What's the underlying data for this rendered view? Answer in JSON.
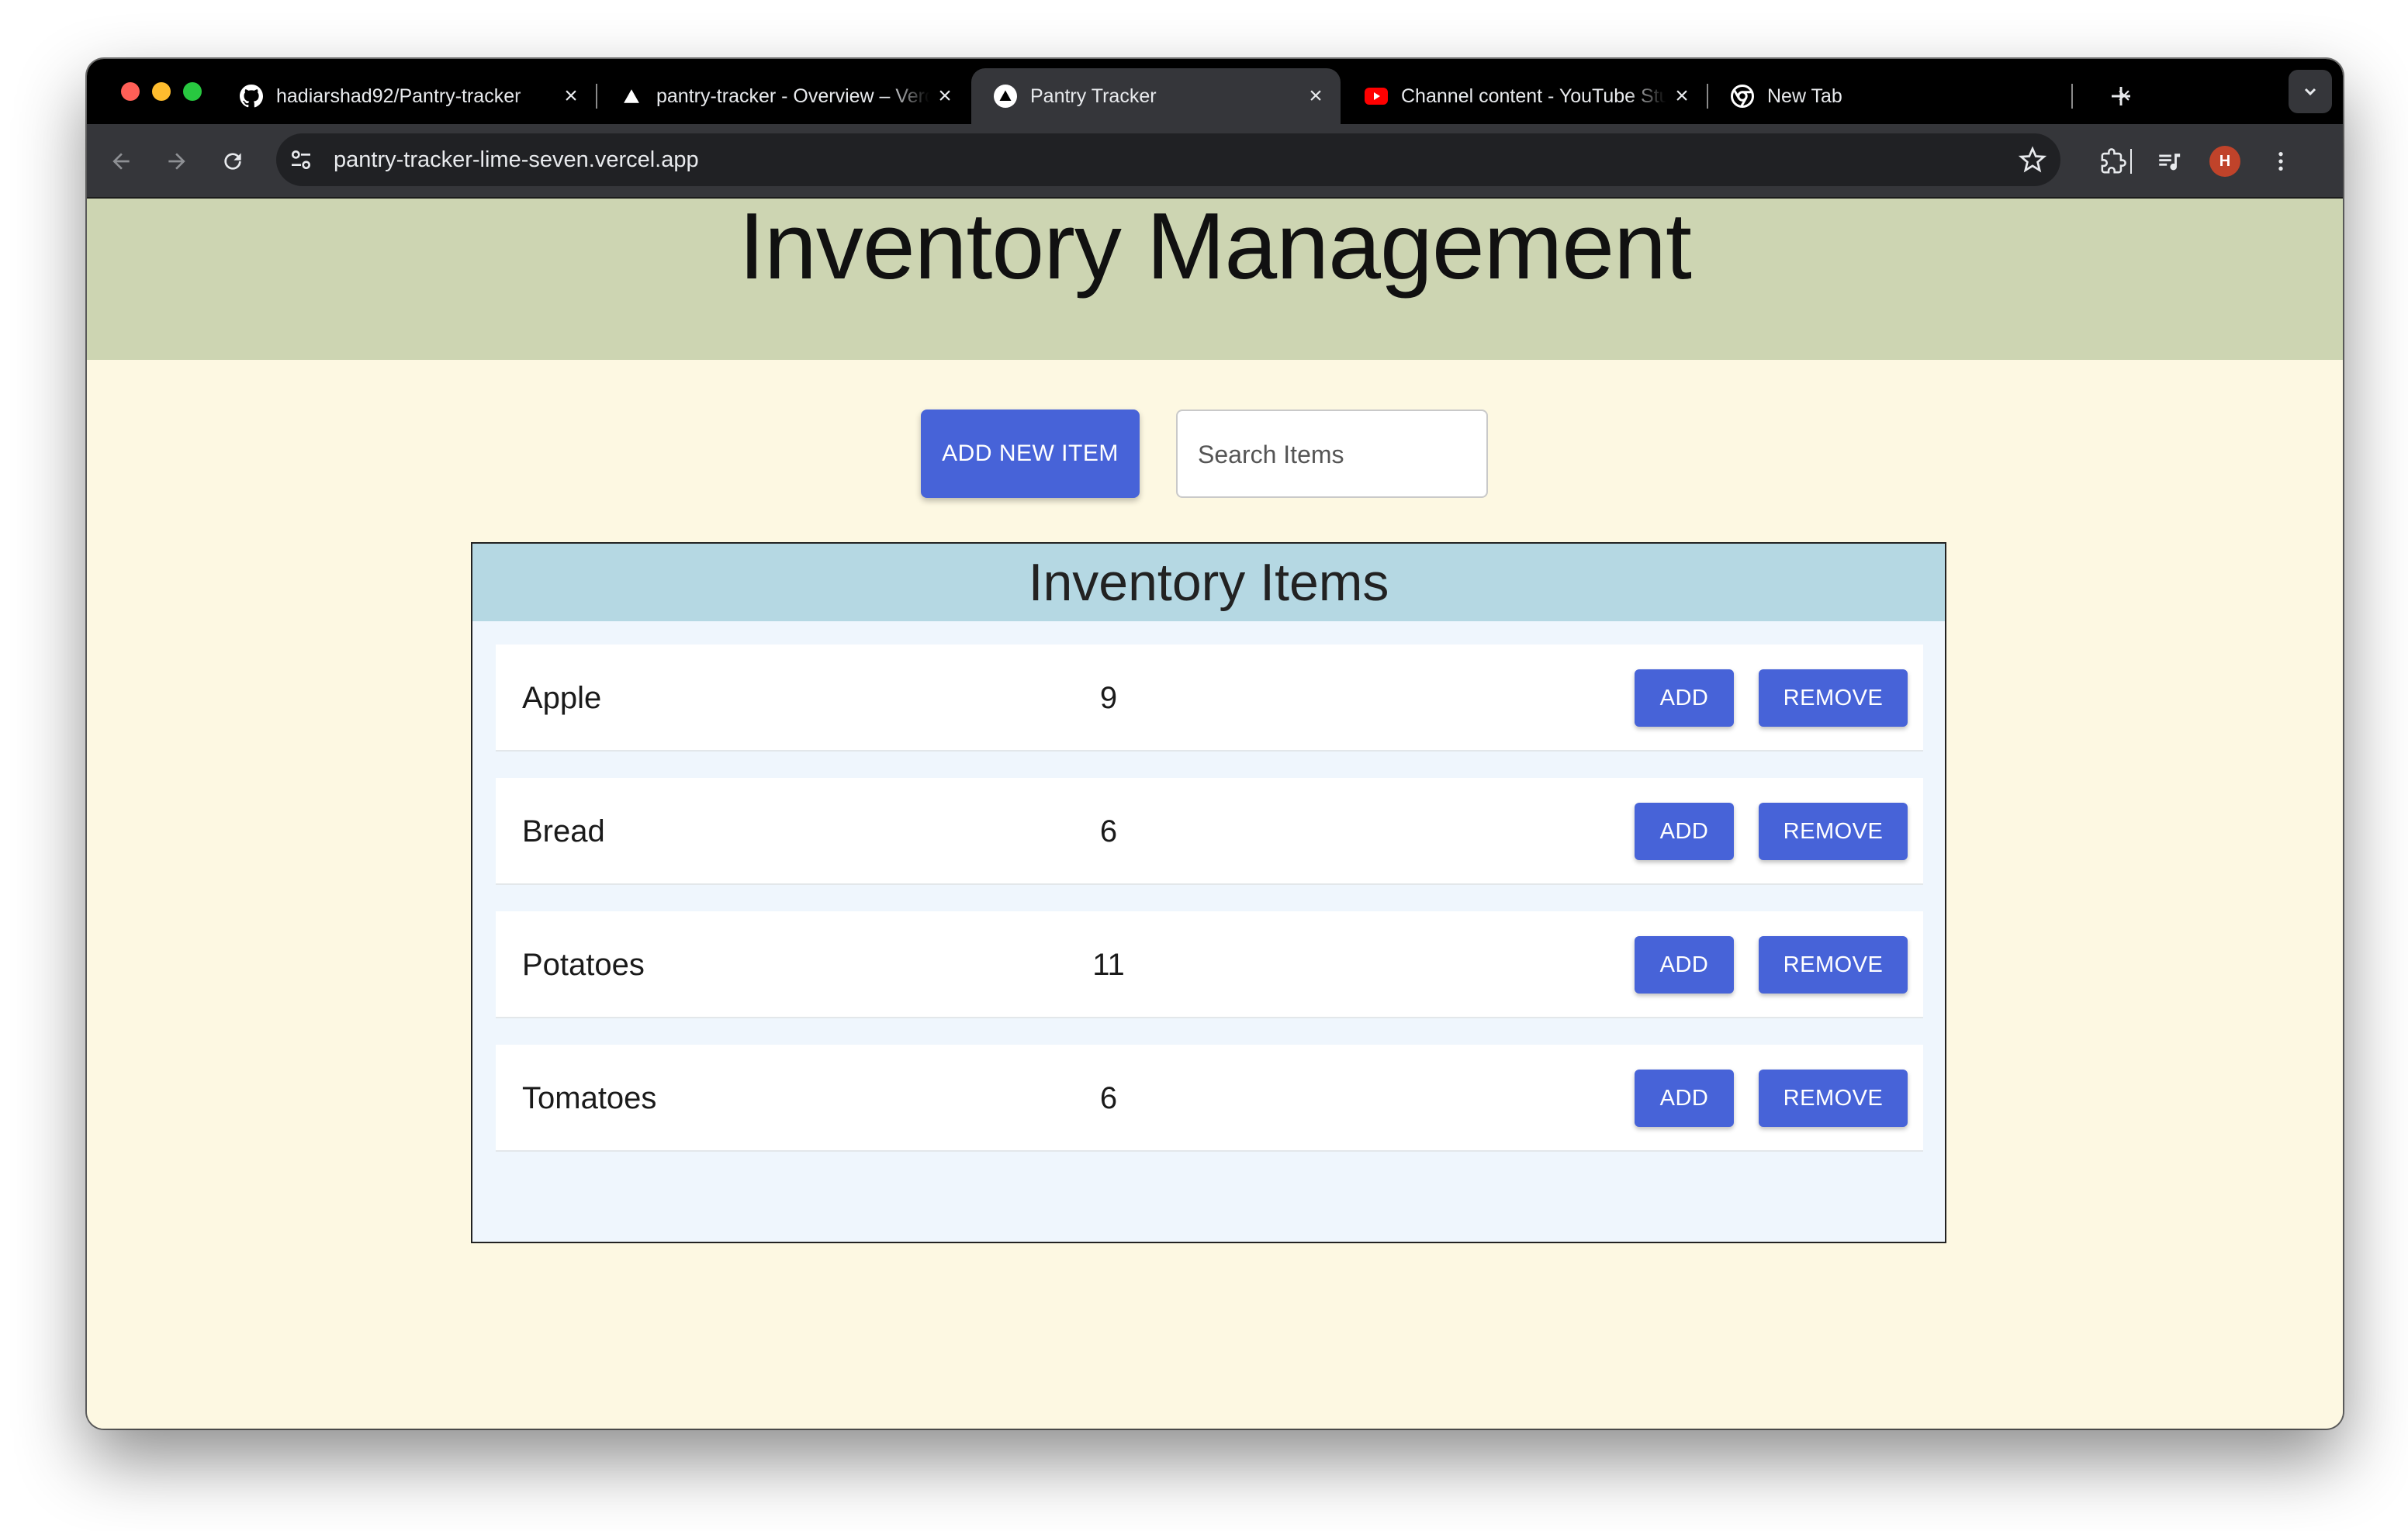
{
  "browser": {
    "tabs": [
      {
        "title": "hadiarshad92/Pantry-tracker",
        "icon": "github-icon",
        "active": false
      },
      {
        "title": "pantry-tracker - Overview – Vercel",
        "icon": "vercel-icon",
        "active": false
      },
      {
        "title": "Pantry Tracker",
        "icon": "vercel-icon",
        "active": true
      },
      {
        "title": "Channel content - YouTube Studio",
        "icon": "youtube-icon",
        "active": false
      },
      {
        "title": "New Tab",
        "icon": "chrome-icon",
        "active": false
      }
    ],
    "close_glyph": "×",
    "url": "pantry-tracker-lime-seven.vercel.app",
    "profile_initial": "H"
  },
  "page": {
    "title": "Inventory Management",
    "add_button_label": "ADD NEW ITEM",
    "search_placeholder": "Search Items",
    "inventory_title": "Inventory Items",
    "items": [
      {
        "name": "Apple",
        "quantity": "9"
      },
      {
        "name": "Bread",
        "quantity": "6"
      },
      {
        "name": "Potatoes",
        "quantity": "11"
      },
      {
        "name": "Tomatoes",
        "quantity": "6"
      }
    ],
    "add_label": "ADD",
    "remove_label": "REMOVE"
  },
  "colors": {
    "header_band": "#cdd5b2",
    "page_background": "#fdf8e2",
    "button_blue": "#4763d8",
    "inventory_header": "#b5d8e3"
  }
}
